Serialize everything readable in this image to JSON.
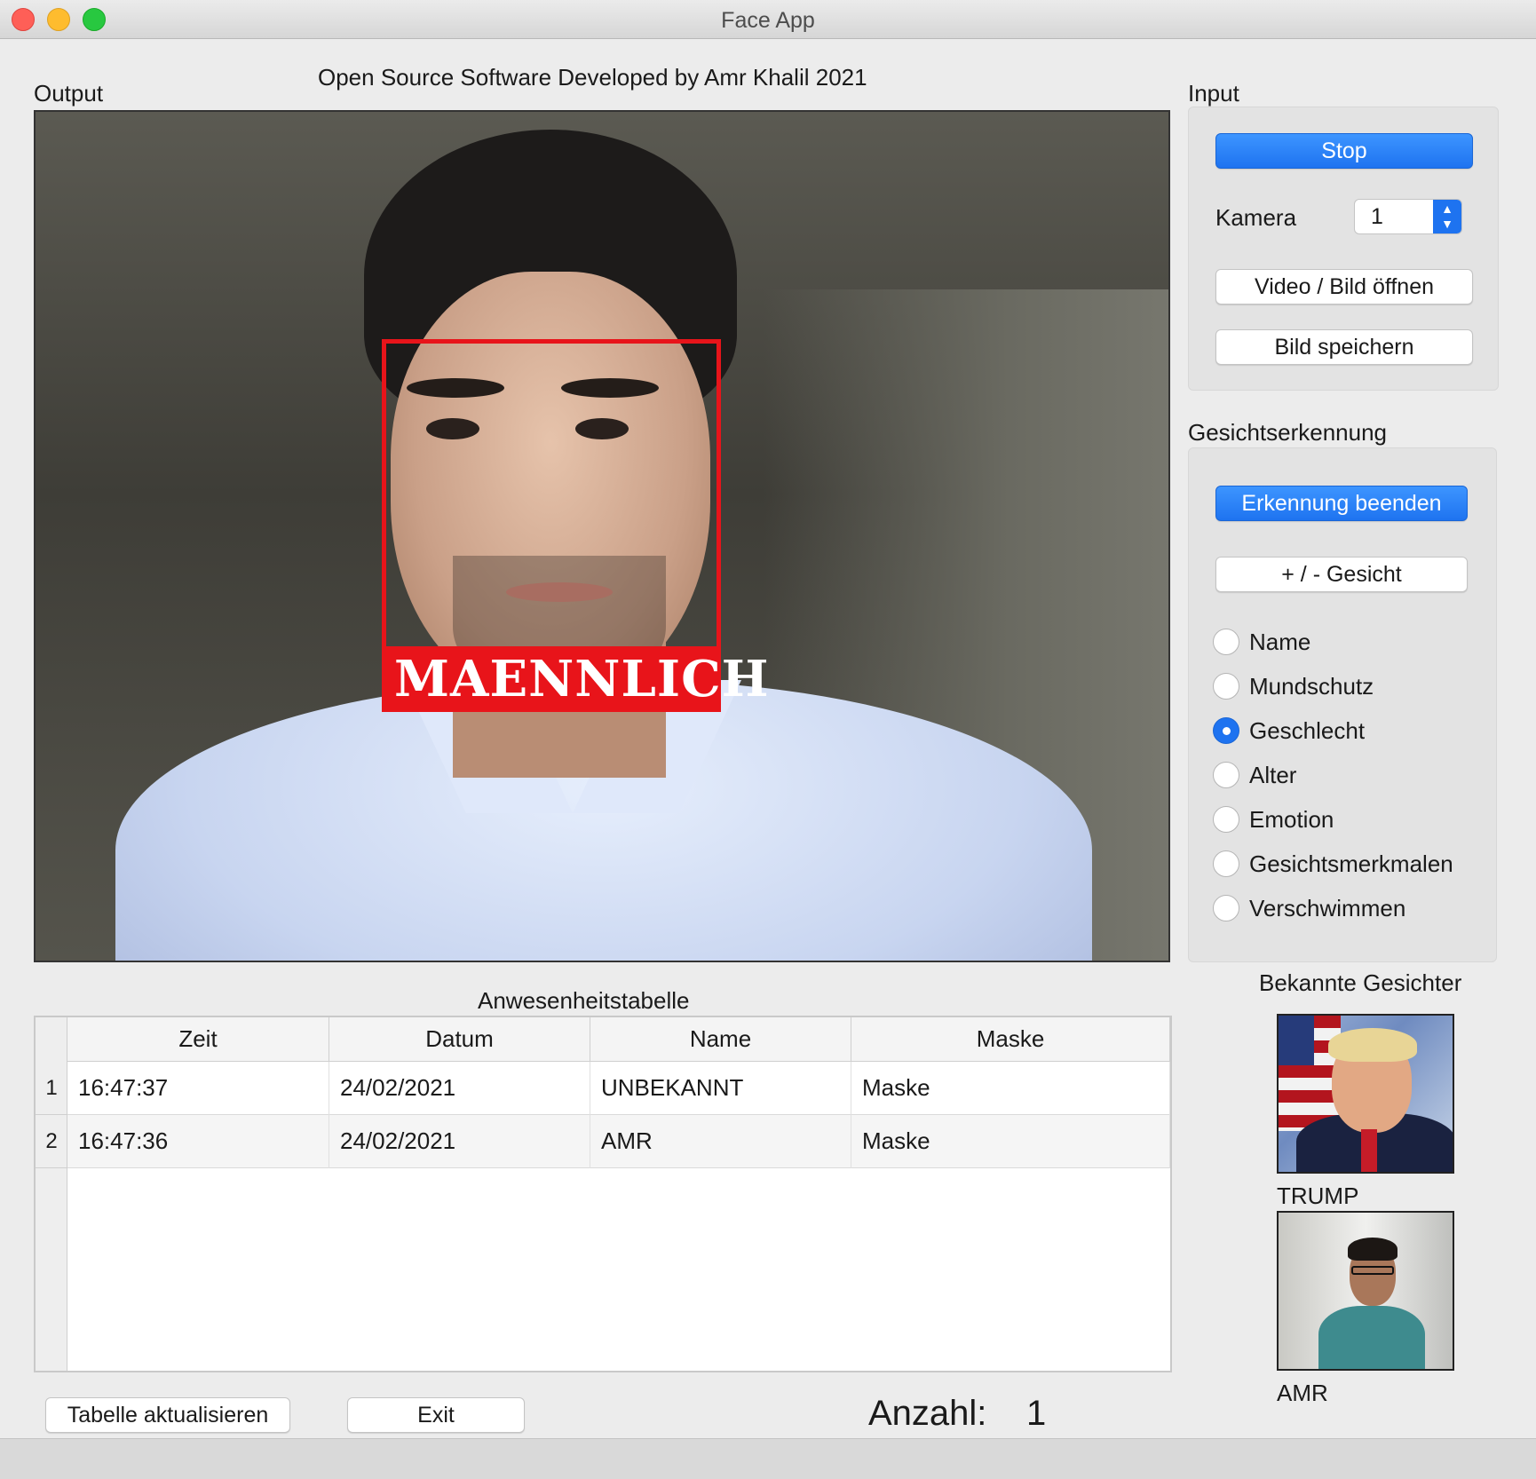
{
  "window": {
    "title": "Face App"
  },
  "header": {
    "credit": "Open Source Software Developed by Amr Khalil 2021"
  },
  "output": {
    "label": "Output",
    "detection_label": "MAENNLICH"
  },
  "input": {
    "label": "Input",
    "stop_label": "Stop",
    "camera_label": "Kamera",
    "camera_value": "1",
    "open_label": "Video / Bild  öffnen",
    "save_label": "Bild speichern"
  },
  "recognition": {
    "label": "Gesichtserkennung",
    "end_label": "Erkennung beenden",
    "face_toggle_label": "+ / - Gesicht",
    "options": [
      "Name",
      "Mundschutz",
      "Geschlecht",
      "Alter",
      "Emotion",
      "Gesichtsmerkmalen",
      "Verschwimmen"
    ],
    "selected": "Geschlecht"
  },
  "known_faces": {
    "label": "Bekannte Gesichter",
    "items": [
      {
        "name": "TRUMP"
      },
      {
        "name": "AMR"
      }
    ]
  },
  "attendance": {
    "title": "Anwesenheitstabelle",
    "columns": [
      "Zeit",
      "Datum",
      "Name",
      "Maske"
    ],
    "rows": [
      {
        "num": "1",
        "zeit": "16:47:37",
        "datum": "24/02/2021",
        "name": "UNBEKANNT",
        "maske": "Maske"
      },
      {
        "num": "2",
        "zeit": "16:47:36",
        "datum": "24/02/2021",
        "name": "AMR",
        "maske": "Maske"
      }
    ]
  },
  "footer": {
    "refresh_label": "Tabelle aktualisieren",
    "exit_label": "Exit",
    "count_label": "Anzahl:",
    "count_value": "1"
  },
  "colors": {
    "accent": "#1e73f0",
    "detection_box": "#e8141a"
  }
}
